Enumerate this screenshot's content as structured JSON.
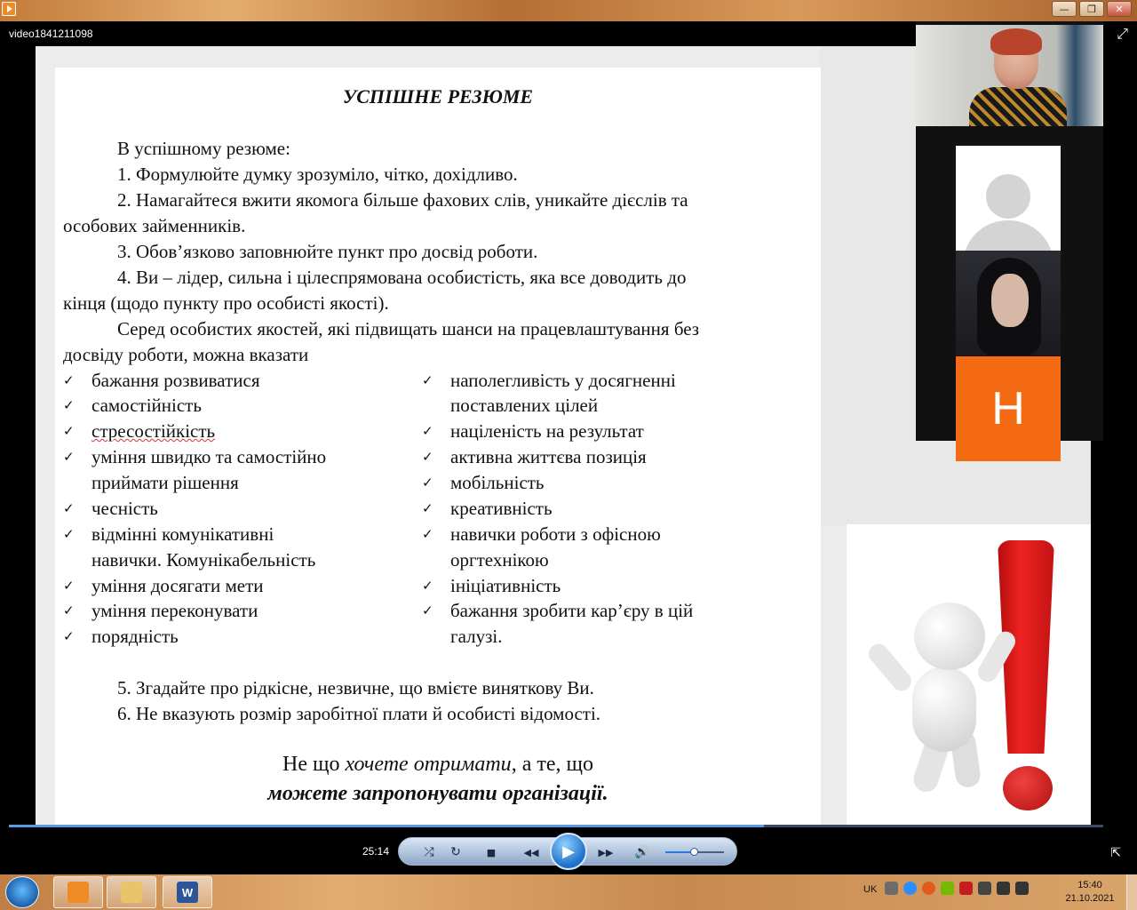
{
  "window": {
    "file_title": "video1841211098",
    "minimize_symbol": "—",
    "maximize_symbol": "❐",
    "close_symbol": "✕"
  },
  "slide": {
    "title": "УСПІШНЕ РЕЗЮМЕ",
    "paragraphs": [
      "В успішному резюме:",
      "1. Формулюйте думку зрозуміло, чітко, дохідливо.",
      "2. Намагайтеся вжити якомога більше фахових слів, уникайте дієслів та",
      "особових займенників.",
      "3. Обов’язково заповнюйте пункт про досвід роботи.",
      "4. Ви – лідер, сильна і цілеспрямована особистість, яка все доводить до",
      "кінця (щодо пункту про особисті якості).",
      "Серед особистих якостей, які підвищать шанси на працевлаштування без",
      "досвіду роботи, можна вказати"
    ],
    "left_list": [
      [
        "бажання розвиватися"
      ],
      [
        "самостійність"
      ],
      [
        "стресостійкість"
      ],
      [
        "уміння швидко та самостійно",
        "приймати рішення"
      ],
      [
        "чесність"
      ],
      [
        "відмінні комунікативні",
        "навички. Комунікабельність"
      ],
      [
        "уміння досягати мети"
      ],
      [
        "уміння переконувати"
      ],
      [
        "порядність"
      ]
    ],
    "right_list": [
      [
        "наполегливість у досягненні",
        "поставлених цілей"
      ],
      [
        "націленість на результат"
      ],
      [
        "активна життєва позиція"
      ],
      [
        "мобільність"
      ],
      [
        "креативність"
      ],
      [
        "навички роботи з офісною",
        "оргтехнікою"
      ],
      [
        "ініціативність"
      ],
      [
        "бажання зробити кар’єру в цій",
        "галузі."
      ]
    ],
    "check_mark": "✓",
    "point5": "5. Згадайте про рідкісне, незвичне, що вмієте виняткову Ви.",
    "point6": "6. Не вказують розмір заробітної плати й особисті відомості.",
    "quote_line1_a": "Не що ",
    "quote_line1_b": "хочете отримати",
    "quote_line1_c": ", а те, що",
    "quote_line2": "можете запропонувати організації."
  },
  "participants": {
    "letter_tile": "Н",
    "letter_tile_color": "#f46a12"
  },
  "player": {
    "elapsed_time": "25:14",
    "progress_fraction": 0.69,
    "volume_fraction": 0.48,
    "play_symbol": "▶",
    "stop_symbol": "■",
    "rewind_symbol": "◀◀",
    "forward_symbol": "▶▶",
    "volume_symbol": "🔊",
    "repeat_symbol": "↻",
    "shuffle_symbol": "⤮",
    "fullscreen_symbol": "⤢",
    "resize_symbol": "⇱"
  },
  "taskbar": {
    "word_label": "W",
    "language": "UK",
    "time": "15:40",
    "date": "21.10.2021"
  }
}
